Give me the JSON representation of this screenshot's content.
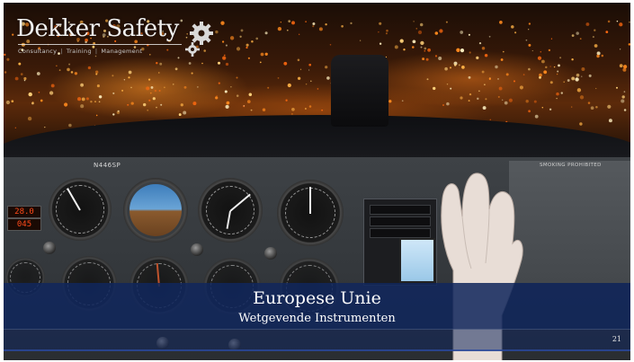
{
  "logo": {
    "name": "Dekker Safety",
    "tagline": [
      "Consultancy",
      "Training",
      "Management"
    ]
  },
  "cockpit": {
    "tail_number": "N446SP",
    "placard": "SMOKING PROHIBITED",
    "fuel_readout_top": "28.0",
    "fuel_readout_bottom": "045"
  },
  "slide": {
    "title": "Europese Unie",
    "subtitle": "Wetgevende Instrumenten",
    "page_number": "21"
  },
  "colors": {
    "title_band": "#10265c",
    "city_lights": "#ff9a2a"
  }
}
